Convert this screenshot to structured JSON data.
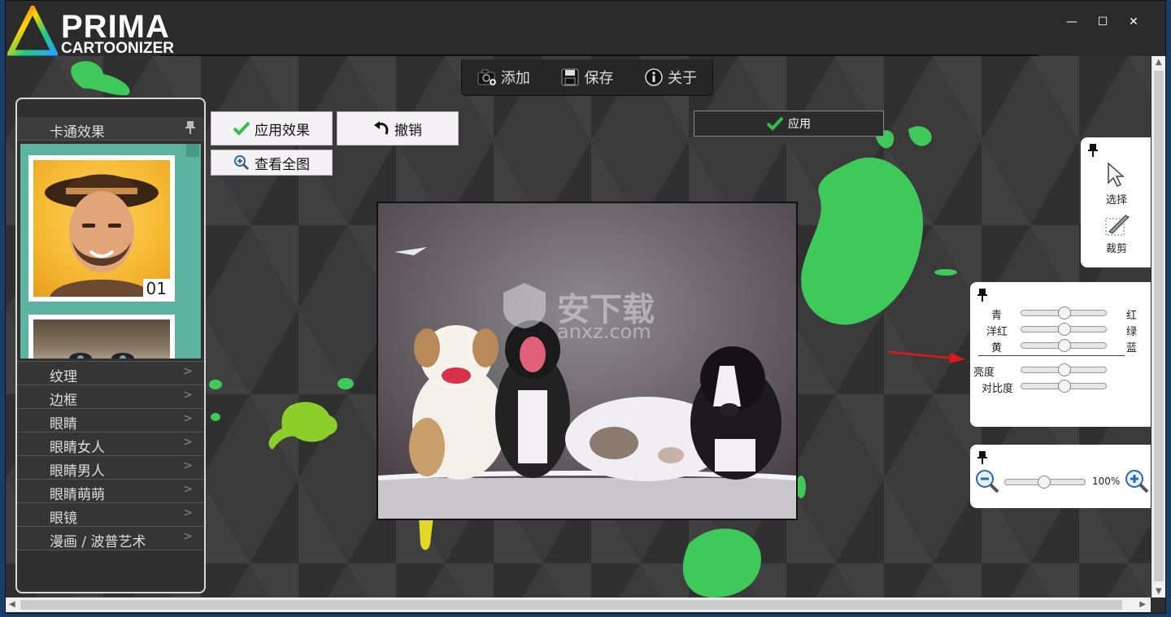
{
  "app": {
    "logo_line1": "PRIMA",
    "logo_line2": "CARTOONIZER"
  },
  "window_controls": {
    "minimize": "—",
    "maximize": "☐",
    "close": "✕"
  },
  "toolbar": {
    "add_label": "添加",
    "save_label": "保存",
    "about_label": "关于"
  },
  "left_panel": {
    "title": "卡通效果",
    "thumb_number": "01",
    "items": [
      {
        "label": "纹理"
      },
      {
        "label": "边框"
      },
      {
        "label": "眼睛"
      },
      {
        "label": "眼睛女人"
      },
      {
        "label": "眼睛男人"
      },
      {
        "label": "眼睛萌萌"
      },
      {
        "label": "眼镜"
      },
      {
        "label": "漫画 / 波普艺术"
      }
    ]
  },
  "actions": {
    "apply_effect": "应用效果",
    "undo": "撤销",
    "view_all": "查看全图",
    "apply": "应用"
  },
  "watermark": {
    "text": "安下载",
    "url": "anxz.com"
  },
  "select_crop_panel": {
    "select_label": "选择",
    "crop_label": "裁剪"
  },
  "color_panel": {
    "rows": [
      {
        "left": "青",
        "right": "红",
        "value": 0.5
      },
      {
        "left": "洋红",
        "right": "绿",
        "value": 0.5
      },
      {
        "left": "黄",
        "right": "蓝",
        "value": 0.5
      }
    ],
    "brightness_label": "亮度",
    "brightness_value": 0.5,
    "contrast_label": "对比度",
    "contrast_value": 0.5
  },
  "zoom_panel": {
    "zoom_value": 0.48,
    "zoom_text": "100%"
  },
  "colors": {
    "accent_green": "#2fbf4a",
    "splash_green": "#3ec95a",
    "lime": "#8ccf2a",
    "teal_gallery": "#5bb3a0",
    "arrow_red": "#e01818"
  }
}
